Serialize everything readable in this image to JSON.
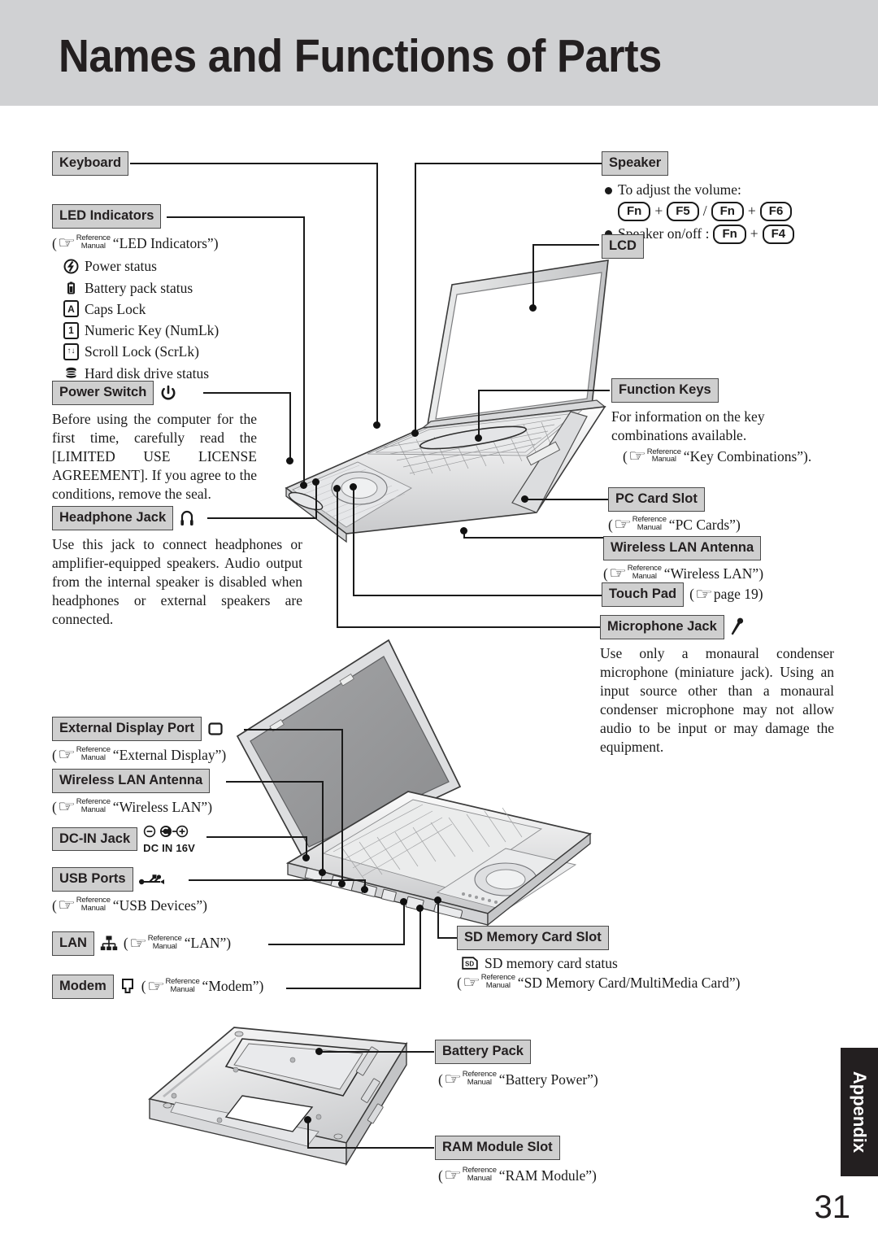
{
  "page": {
    "title": "Names and Functions of Parts",
    "number": "31",
    "tab_label": "Appendix"
  },
  "reference": {
    "hand_icon": "pointing-hand-icon",
    "line1": "Reference",
    "line2": "Manual",
    "open_paren": "(",
    "close_paren": ")"
  },
  "left_column": {
    "keyboard": {
      "label": "Keyboard"
    },
    "led_indicators": {
      "label": "LED Indicators",
      "ref_text": "“LED Indicators”)",
      "items": [
        {
          "icon": "power-status-icon",
          "glyph": "ⓘ",
          "label": "Power status"
        },
        {
          "icon": "battery-status-icon",
          "glyph": "▮",
          "label": "Battery pack status"
        },
        {
          "icon": "caps-lock-icon",
          "glyph": "A",
          "label": "Caps Lock"
        },
        {
          "icon": "num-lock-icon",
          "glyph": "1",
          "label": "Numeric Key (NumLk)"
        },
        {
          "icon": "scroll-lock-icon",
          "glyph": "↑↓",
          "label": "Scroll Lock (ScrLk)"
        },
        {
          "icon": "hard-disk-icon",
          "glyph": "☰",
          "label": "Hard disk drive status"
        }
      ]
    },
    "power_switch": {
      "label": "Power Switch",
      "icon": "power-symbol-icon",
      "body": "Before using the computer for the first time, carefully read the [LIMITED USE LICENSE AGREEMENT].  If you agree to the conditions, remove the seal."
    },
    "headphone_jack": {
      "label": "Headphone Jack",
      "icon": "headphone-icon",
      "body": "Use this jack to connect  headphones or amplifier-equipped speakers.  Audio output from the internal speaker is disabled when headphones or external speakers are connected."
    },
    "external_display_port": {
      "label": "External Display Port",
      "icon": "display-port-icon",
      "ref_text": "“External Display”)"
    },
    "wireless_lan_antenna": {
      "label": "Wireless LAN Antenna",
      "ref_text": "“Wireless LAN”)"
    },
    "dc_in_jack": {
      "label": "DC-IN Jack",
      "icon": "dc-polarity-icon",
      "rating": "DC IN 16V"
    },
    "usb_ports": {
      "label": "USB Ports",
      "icon": "usb-icon",
      "ref_text": "“USB Devices”)"
    },
    "lan": {
      "label": "LAN",
      "icon": "lan-network-icon",
      "ref_text": "“LAN”)"
    },
    "modem": {
      "label": "Modem",
      "icon": "modem-jack-icon",
      "ref_text": "“Modem”)"
    }
  },
  "right_column": {
    "speaker": {
      "label": "Speaker",
      "volume_text": "To adjust the volume:",
      "volume_keys": [
        "Fn",
        "+",
        "F5",
        "/",
        "Fn",
        "+",
        "F6"
      ],
      "onoff_text": "Speaker on/off :",
      "onoff_keys": [
        "Fn",
        "+",
        "F4"
      ]
    },
    "lcd": {
      "label": "LCD"
    },
    "function_keys": {
      "label": "Function Keys",
      "body": "For information on the key combinations available.",
      "ref_text": "“Key Combinations”)."
    },
    "pc_card_slot": {
      "label": "PC Card Slot",
      "ref_text": "“PC Cards”)"
    },
    "wireless_lan_antenna": {
      "label": "Wireless LAN Antenna",
      "ref_text": "“Wireless LAN”)"
    },
    "touch_pad": {
      "label": "Touch Pad",
      "page_ref": "page  19)"
    },
    "microphone_jack": {
      "label": "Microphone Jack",
      "icon": "microphone-icon",
      "body": "Use only a monaural condenser microphone (miniature jack).  Using an input source other than a monaural condenser microphone may not allow audio to be input or may damage the equipment."
    },
    "sd_memory_card_slot": {
      "label": "SD Memory Card Slot",
      "status_icon": "sd-card-icon",
      "status_text": "SD memory card status",
      "ref_text": "“SD Memory Card/MultiMedia Card”)"
    },
    "battery_pack": {
      "label": "Battery Pack",
      "ref_text": "“Battery Power”)"
    },
    "ram_module_slot": {
      "label": "RAM Module Slot",
      "ref_text": "“RAM Module”)"
    }
  },
  "figures": {
    "open_laptop_top": "laptop-open-front-view-illustration",
    "open_laptop_left": "laptop-open-left-side-view-illustration",
    "laptop_bottom": "laptop-bottom-view-illustration"
  },
  "colors": {
    "banner": "#d0d1d3",
    "chip_fill": "#cfcfcf",
    "ink": "#231f20",
    "tab": "#231f20"
  }
}
